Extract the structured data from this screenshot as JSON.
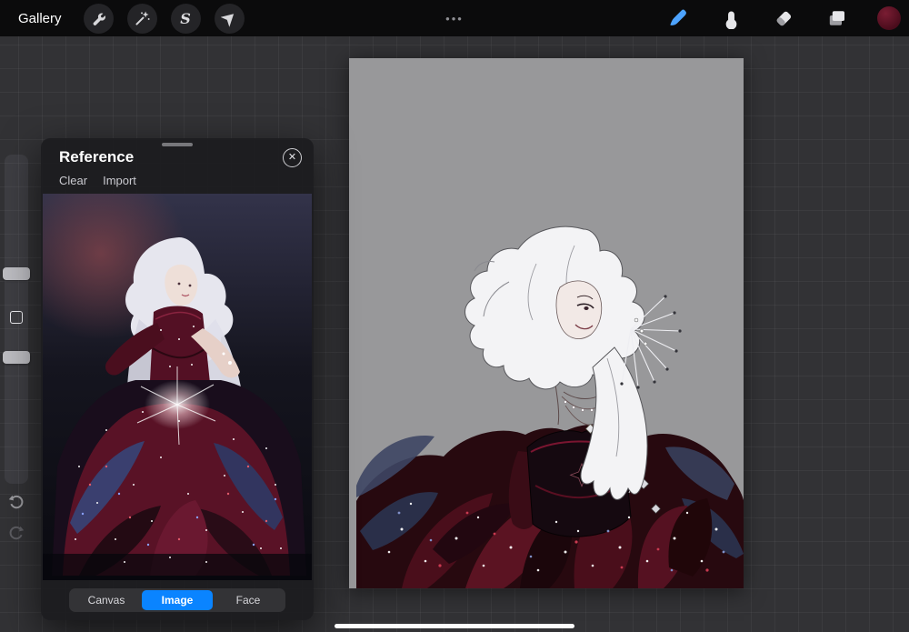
{
  "topbar": {
    "gallery_label": "Gallery",
    "ellipsis_glyph": "•••",
    "selection_glyph": "S",
    "tools_left": [
      {
        "name": "actions",
        "icon": "wrench-icon"
      },
      {
        "name": "adjustments",
        "icon": "magic-wand-icon"
      },
      {
        "name": "selection",
        "icon": "selection-s-icon"
      },
      {
        "name": "transform",
        "icon": "transform-arrow-icon"
      }
    ],
    "tools_right": [
      {
        "name": "paint",
        "icon": "brush-icon",
        "active": true
      },
      {
        "name": "smudge",
        "icon": "smudge-icon",
        "active": false
      },
      {
        "name": "erase",
        "icon": "eraser-icon",
        "active": false
      },
      {
        "name": "layers",
        "icon": "layers-icon",
        "active": false
      },
      {
        "name": "color",
        "icon": "color-swatch",
        "active": false
      }
    ],
    "active_tool_color": "#4da3ff",
    "current_color_swatch": "#5c1124"
  },
  "sidebar": {
    "controls": [
      "brush-size-slider",
      "modify-button",
      "opacity-slider",
      "undo-button",
      "redo-button"
    ]
  },
  "reference_panel": {
    "title": "Reference",
    "clear_label": "Clear",
    "import_label": "Import",
    "close_glyph": "✕",
    "tabs": [
      {
        "label": "Canvas",
        "active": false
      },
      {
        "label": "Image",
        "active": true
      },
      {
        "label": "Face",
        "active": false
      }
    ],
    "active_tab_color": "#0a84ff"
  },
  "canvas": {
    "background": "#98989a"
  }
}
